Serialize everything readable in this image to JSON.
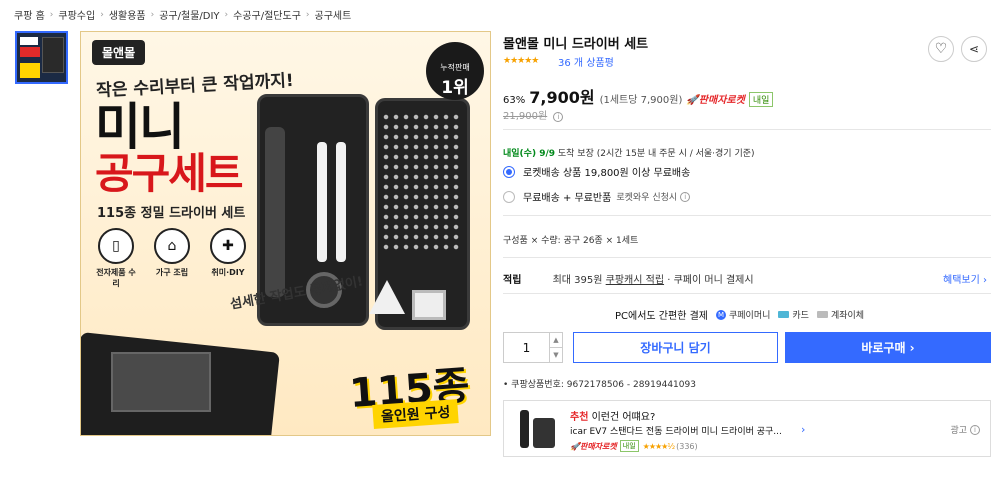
{
  "breadcrumb": [
    "쿠팡 홈",
    "쿠팡수입",
    "생활용품",
    "공구/철물/DIY",
    "수공구/절단도구",
    "공구세트"
  ],
  "main_image": {
    "brand": "몰앤몰",
    "headline_small": "작은 수리부터 큰 작업까지!",
    "headline_big": "미니",
    "headline_red": "공구세트",
    "headline_sub": "115종 정밀 드라이버 세트",
    "features": [
      "전자제품 수리",
      "가구 조립",
      "취미·DIY"
    ],
    "rank_small": "누적판매",
    "rank_big": "1위",
    "note": "섬세한 작업도 문제없이!",
    "count_big": "115종",
    "count_sub": "올인원 구성"
  },
  "product": {
    "title": "몰앤몰 미니 드라이버 세트",
    "stars": "★★★★★",
    "reviews": "36 개 상품평",
    "discount": "63%",
    "price": "7,900원",
    "unit_price": "(1세트당 7,900원)",
    "rocket": "🚀판매자로켓",
    "rocket_tag": "내일",
    "orig_price": "21,900원",
    "delivery_date": "내일(수) 9/9",
    "delivery_word": "도착 보장",
    "delivery_note": "(2시간 15분 내 주문 시 / 서울·경기 기준)",
    "ship_option1": "로켓배송 상품 19,800원 이상 무료배송",
    "ship_option2": "무료배송 + 무료반품",
    "ship_option2_sub": "로켓와우 신청시",
    "composition": "구성품 × 수량: 공구 26종 × 1세트",
    "reward_label": "적립",
    "reward_text1": "최대 395원",
    "reward_link": "쿠팡캐시 적립",
    "reward_text2": "· 쿠페이 머니 결제시",
    "reward_more": "혜택보기 ›",
    "pc_pay_label": "PC에서도 간편한 결제",
    "pay_methods": [
      "쿠페이머니",
      "카드",
      "계좌이체"
    ],
    "quantity": "1",
    "cart_button": "장바구니 담기",
    "buy_button": "바로구매 ›",
    "product_no": "• 쿠팡상품번호: 9672178506 - 28919441093"
  },
  "recommend": {
    "label": "추천",
    "title": "이런건 어떄요?",
    "desc": "icar EV7 스탠다드 전동 드라이버 미니 드라이버 공구...",
    "rocket": "🚀판매자로켓",
    "tag": "내일",
    "stars": "★★★★½",
    "count": "(336)",
    "ad_label": "광고"
  },
  "colors": {
    "accent_blue": "#346aff",
    "rocket_red": "#e52528",
    "star_orange": "#f7a100",
    "delivery_green": "#00891a"
  },
  "icons": {
    "heart": "heart-icon",
    "share": "share-icon",
    "info": "info-icon",
    "chevron": "chevron-right-icon"
  }
}
